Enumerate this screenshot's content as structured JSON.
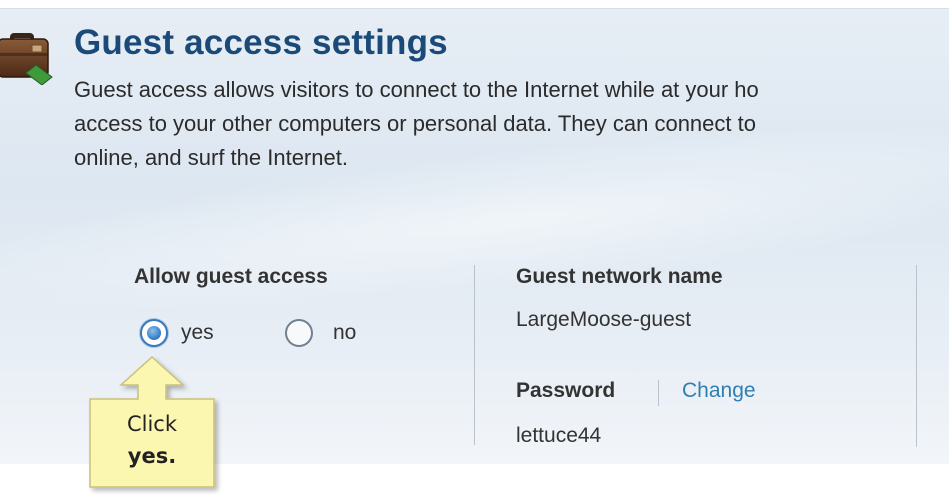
{
  "page": {
    "title": "Guest access settings",
    "description_lines": [
      "Guest access allows visitors to connect to the Internet while at your ho",
      "access to your other computers or personal data. They can connect to",
      "online, and surf the Internet."
    ]
  },
  "allow_guest_access": {
    "label": "Allow guest access",
    "options": [
      {
        "label": "yes",
        "selected": true
      },
      {
        "label": "no",
        "selected": false
      }
    ]
  },
  "guest_network": {
    "name_label": "Guest network name",
    "name_value": "LargeMoose-guest",
    "password_label": "Password",
    "change_link": "Change",
    "password_value": "lettuce44"
  },
  "callout": {
    "line1": "Click",
    "line2": "yes."
  },
  "icons": {
    "header_icon": "suitcase-icon"
  },
  "colors": {
    "title": "#1c4a78",
    "link": "#2e7fb2",
    "callout_fill": "#fbf7b0"
  }
}
